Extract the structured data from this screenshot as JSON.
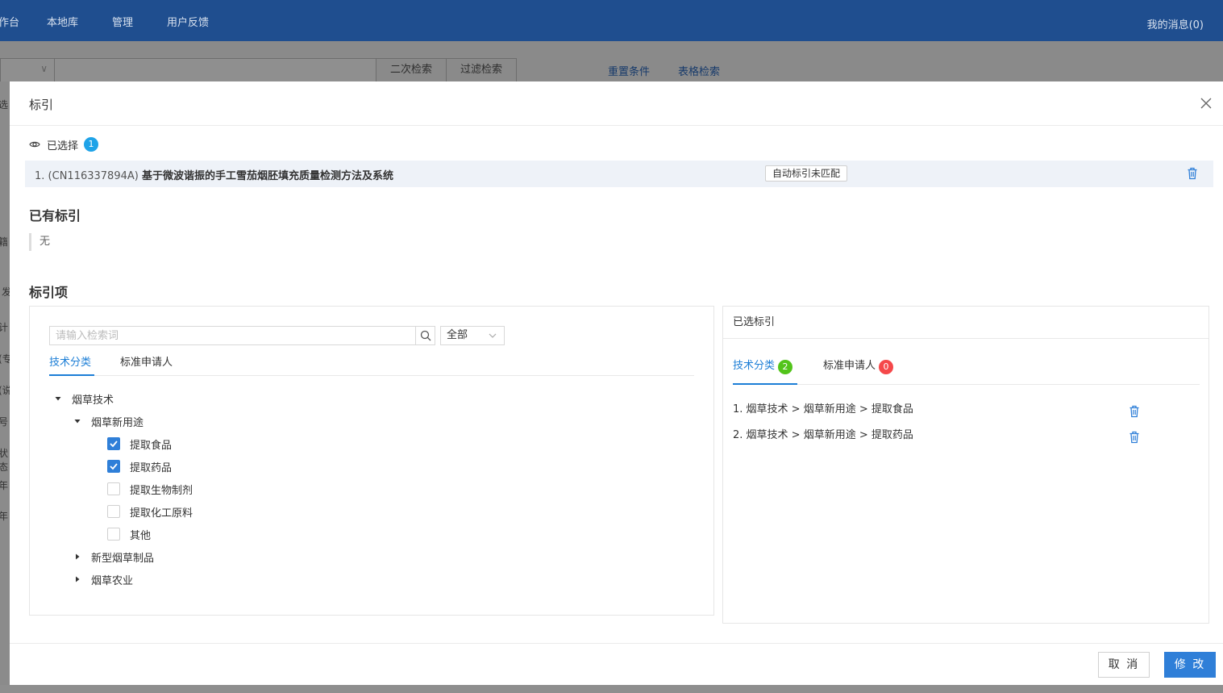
{
  "nav": {
    "items": [
      "作台",
      "本地库",
      "管理",
      "用户反馈"
    ],
    "messages": "我的消息(0)"
  },
  "toolbar": {
    "secondary_search": "二次检索",
    "filter_search": "过滤检索",
    "reset": "重置条件",
    "table_search": "表格检索"
  },
  "background_left": [
    "选",
    "籍",
    "发",
    "计",
    "(专",
    "(说",
    "号",
    "状态",
    "年",
    "年"
  ],
  "modal": {
    "title": "标引",
    "selected_label": "已选择",
    "selected_count": "1",
    "selected_item": {
      "index": "1.",
      "number": "(CN116337894A)",
      "title": "基于微波谐振的手工雪茄烟胚填充质量检测方法及系统",
      "tag": "自动标引未匹配"
    },
    "existing_title": "已有标引",
    "existing_value": "无",
    "items_title": "标引项"
  },
  "left_panel": {
    "search_placeholder": "请输入检索词",
    "scope": "全部",
    "tabs": [
      "技术分类",
      "标准申请人"
    ],
    "tree": {
      "root": "烟草技术",
      "child": "烟草新用途",
      "leaves": [
        {
          "label": "提取食品",
          "checked": true
        },
        {
          "label": "提取药品",
          "checked": true
        },
        {
          "label": "提取生物制剂",
          "checked": false
        },
        {
          "label": "提取化工原料",
          "checked": false
        },
        {
          "label": "其他",
          "checked": false
        }
      ],
      "collapsed": [
        "新型烟草制品",
        "烟草农业"
      ]
    }
  },
  "right_panel": {
    "title": "已选标引",
    "tabs": [
      {
        "label": "技术分类",
        "count": "2"
      },
      {
        "label": "标准申请人",
        "count": "0"
      }
    ],
    "items": [
      "1. 烟草技术 > 烟草新用途 > 提取食品",
      "2. 烟草技术 > 烟草新用途 > 提取药品"
    ]
  },
  "footer": {
    "cancel": "取 消",
    "confirm": "修 改"
  },
  "colors": {
    "nav": "#1f4e8f",
    "accent": "#1c7ed6",
    "primary_button": "#2f7fd8",
    "badge_blue": "#1fa3e8",
    "badge_green": "#52c41a",
    "badge_red": "#f5484a"
  },
  "icons": [
    "eye-icon",
    "trash-icon",
    "close-icon",
    "search-icon",
    "chevron-down-icon",
    "caret-down-icon",
    "caret-right-icon",
    "check-icon"
  ]
}
